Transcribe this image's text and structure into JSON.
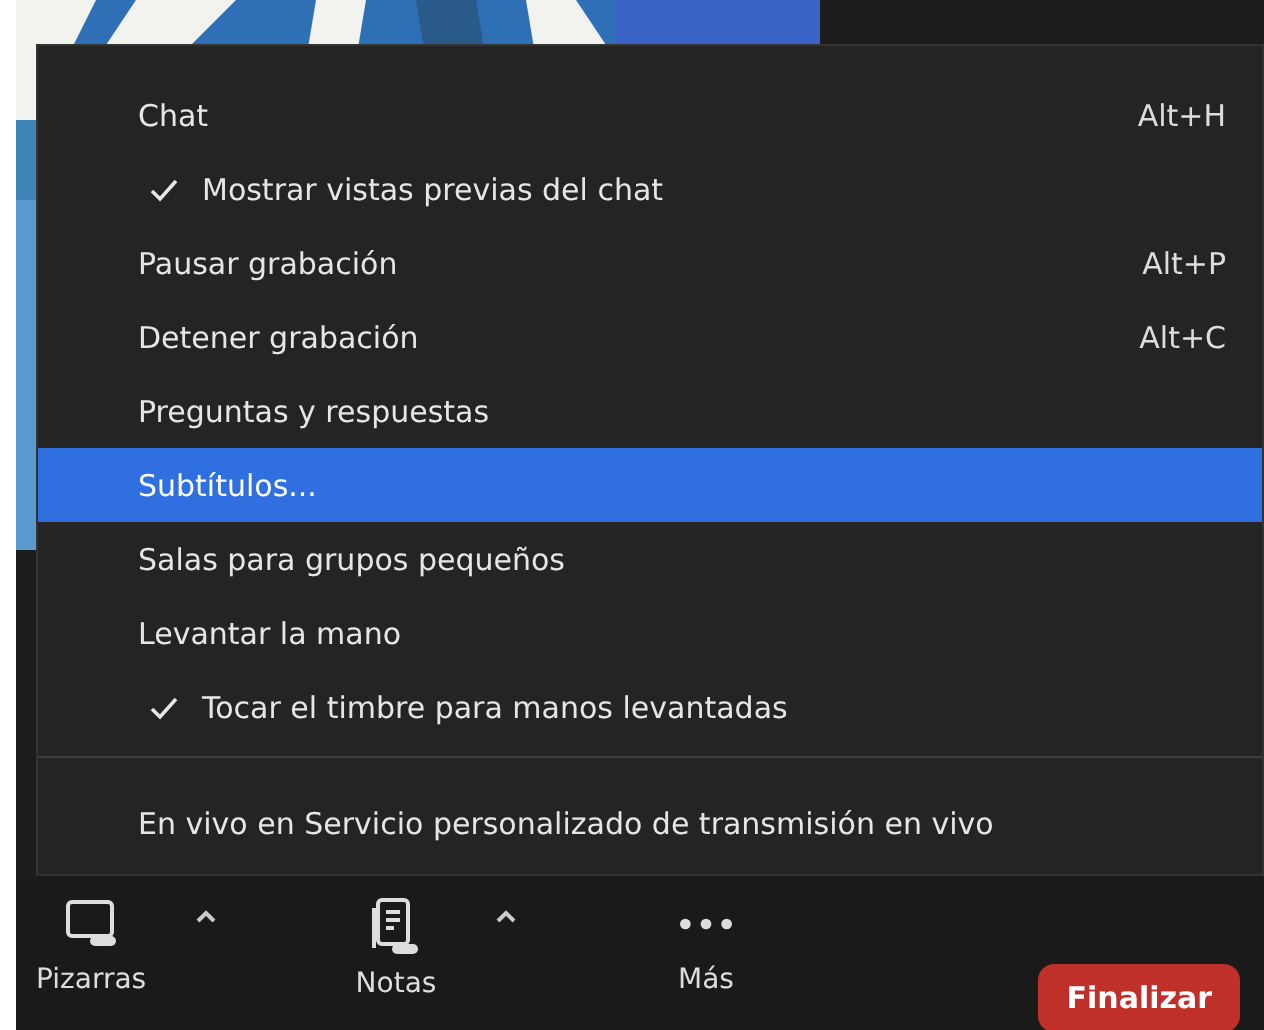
{
  "menu": {
    "items": [
      {
        "kind": "item",
        "label": "Chat",
        "shortcut": "Alt+H",
        "checked": false,
        "selected": false
      },
      {
        "kind": "item",
        "label": "Mostrar vistas previas del chat",
        "checked": true,
        "selected": false
      },
      {
        "kind": "item",
        "label": "Pausar grabación",
        "shortcut": "Alt+P",
        "checked": false,
        "selected": false
      },
      {
        "kind": "item",
        "label": "Detener grabación",
        "shortcut": "Alt+C",
        "checked": false,
        "selected": false
      },
      {
        "kind": "item",
        "label": "Preguntas y respuestas",
        "checked": false,
        "selected": false
      },
      {
        "kind": "item",
        "label": "Subtítulos...",
        "checked": false,
        "selected": true
      },
      {
        "kind": "item",
        "label": "Salas para grupos pequeños",
        "checked": false,
        "selected": false
      },
      {
        "kind": "item",
        "label": "Levantar la mano",
        "checked": false,
        "selected": false
      },
      {
        "kind": "item",
        "label": "Tocar el timbre para manos levantadas",
        "checked": true,
        "selected": false
      },
      {
        "kind": "separator"
      },
      {
        "kind": "item",
        "label": "En vivo en Servicio personalizado de transmisión en vivo",
        "checked": false,
        "selected": false
      }
    ]
  },
  "toolbar": {
    "buttons": [
      {
        "kind": "whiteboard",
        "label": "Pizarras",
        "caret": true
      },
      {
        "kind": "notes",
        "label": "Notas",
        "caret": true
      },
      {
        "kind": "more",
        "label": "Más",
        "caret": false
      }
    ],
    "end_button": "Finalizar"
  }
}
